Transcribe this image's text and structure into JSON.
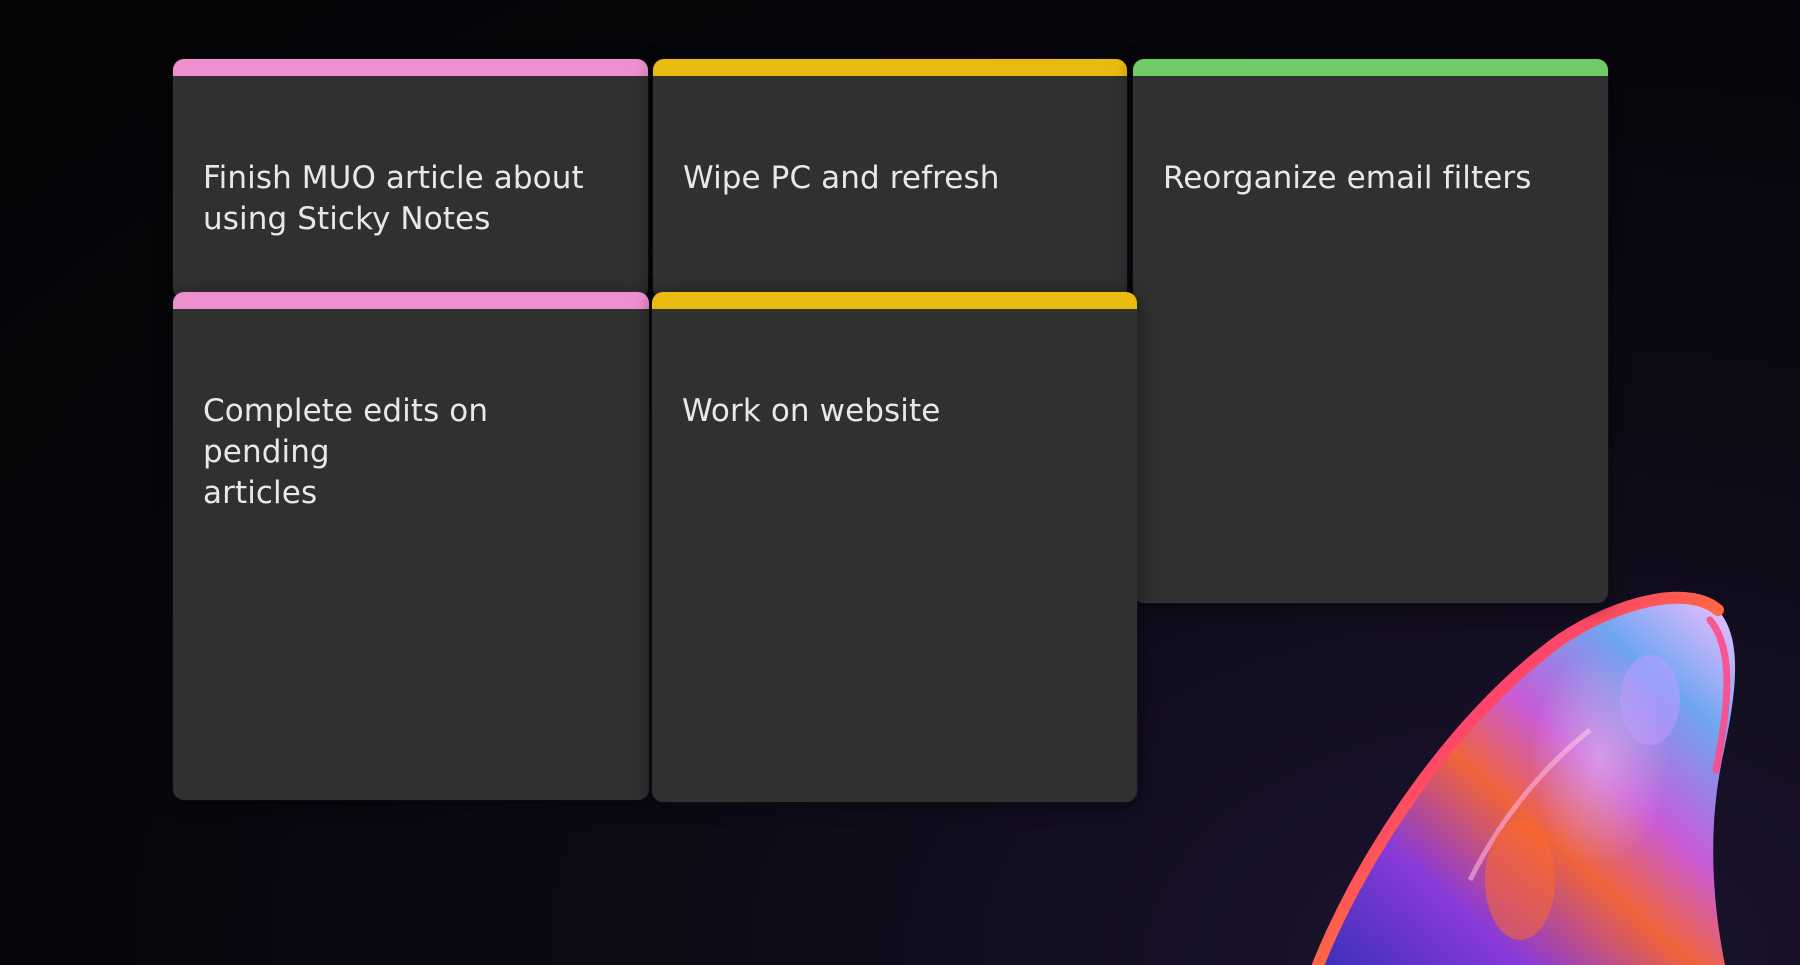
{
  "colors": {
    "note_background": "#303030",
    "pink": "#ee8fcf",
    "yellow": "#e8bb0e",
    "green": "#6fcc67",
    "text": "#e8e8e8"
  },
  "wallpaper": {
    "icon": "windows-bloom-icon"
  },
  "notes": [
    {
      "color": "#ee8fcf",
      "text": "Finish MUO article about\nusing Sticky Notes"
    },
    {
      "color": "#e8bb0e",
      "text": "Wipe PC and refresh"
    },
    {
      "color": "#6fcc67",
      "text": "Reorganize email filters"
    },
    {
      "color": "#ee8fcf",
      "text": "Complete edits on pending\narticles"
    },
    {
      "color": "#e8bb0e",
      "text": "Work on website"
    }
  ]
}
